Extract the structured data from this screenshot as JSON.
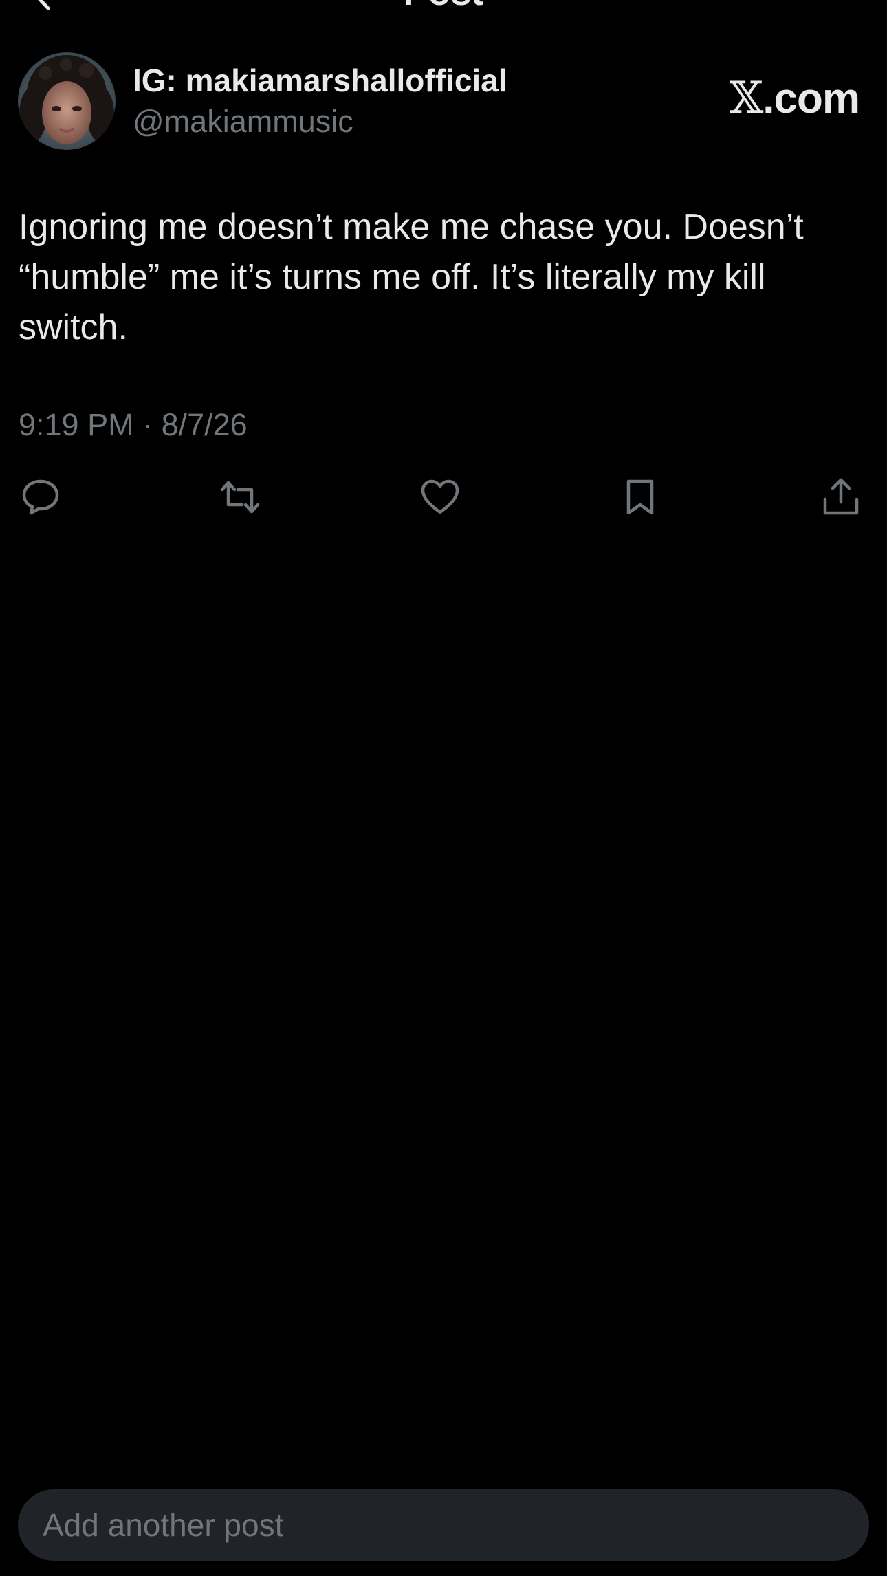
{
  "header": {
    "title": "Post"
  },
  "author": {
    "display_name": "IG: makiamarshallofficial",
    "handle": "@makiammusic"
  },
  "brand": {
    "x": "𝕏",
    "suffix": ".com"
  },
  "post": {
    "text": "Ignoring me doesn’t make me chase you. Doesn’t\n“humble” me it’s turns me off.  It’s literally my kill\nswitch.",
    "timestamp": "9:19 PM · 8/7/26"
  },
  "actions": [
    {
      "icon": "reply-icon"
    },
    {
      "icon": "repost-icon"
    },
    {
      "icon": "like-icon"
    },
    {
      "icon": "bookmark-icon"
    },
    {
      "icon": "share-icon"
    }
  ],
  "composer": {
    "placeholder": "Add another post"
  },
  "colors": {
    "background": "#000000",
    "primary_text": "#e7e9ea",
    "secondary_text": "#71767b",
    "composer_bg": "#202327"
  }
}
